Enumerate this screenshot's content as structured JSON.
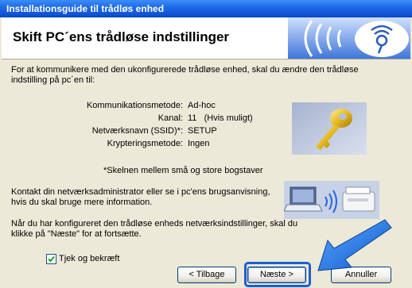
{
  "window": {
    "title": "Installationsguide til trådløs enhed"
  },
  "banner": {
    "title": "Skift PC´ens trådløse indstillinger"
  },
  "intro": "For at kommunikere med den ukonfigurerede trådløse enhed, skal du ændre den trådløse indstilling på pc´en til:",
  "settings": [
    {
      "label": "Kommunikationsmetode:",
      "value": "Ad-hoc"
    },
    {
      "label": "Kanal:",
      "value": "11   (Hvis muligt)"
    },
    {
      "label": "Netværksnavn (SSID)*:",
      "value": "SETUP"
    },
    {
      "label": "Krypteringsmetode:",
      "value": "Ingen"
    }
  ],
  "note": "*Skelnen mellem små og store bogstaver",
  "contact": "Kontakt din netværksadministrator eller se i pc'ens brugsanvisning, hvis du skal bruge mere information.",
  "finish": "Når du har konfigureret den trådløse enheds netværksindstillinger, skal du klikke på \"Næste\" for at fortsætte.",
  "checkbox": {
    "label": "Tjek og bekræft",
    "checked": true
  },
  "buttons": {
    "back": "< Tilbage",
    "next": "Næste >",
    "cancel": "Annuller"
  },
  "colors": {
    "titlebar": "#0f55d8",
    "highlight": "#1a5fd6",
    "arrow": "#1e73d4"
  }
}
